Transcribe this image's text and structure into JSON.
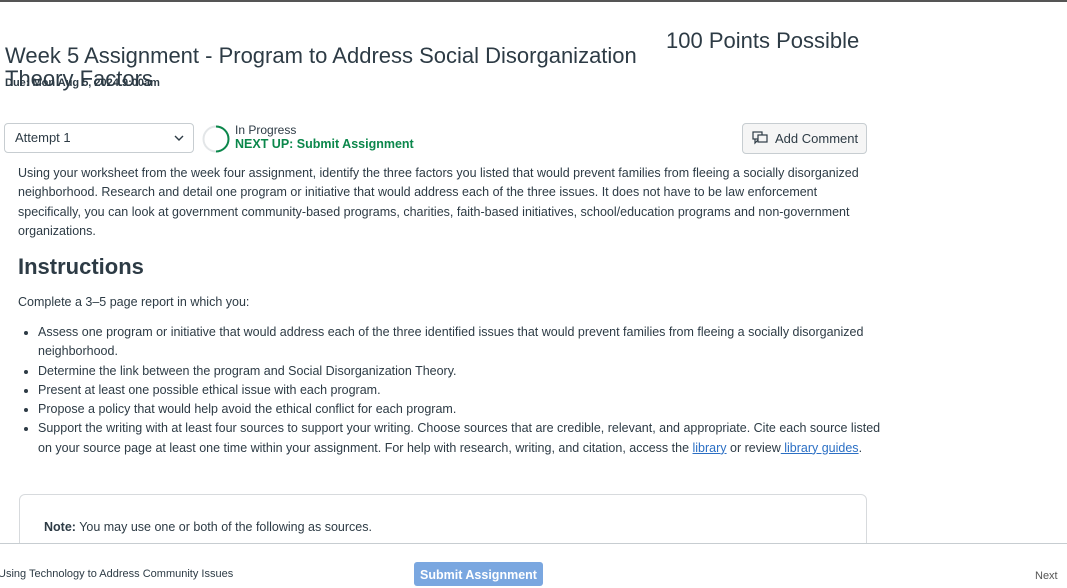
{
  "assignment": {
    "title": "Week 5 Assignment - Program to Address Social Disorganization Theory Factors",
    "points": "100 Points Possible",
    "due": "Due: Mon Aug 5, 2024 9:00am"
  },
  "attempt": {
    "selected": "Attempt 1",
    "status": "In Progress",
    "next_step": "NEXT UP: Submit Assignment"
  },
  "actions": {
    "add_comment": "Add Comment"
  },
  "body": {
    "intro_paragraph": "Using your worksheet from the week four assignment, identify the three factors you listed that would prevent families from fleeing a socially disorganized neighborhood. Research and detail one program or initiative that would address each of the three issues. It does not have to be law enforcement specifically, you can look at government community-based programs, charities, faith-based initiatives, school/education programs and non-government organizations.",
    "instructions_heading": "Instructions",
    "instructions_intro": "Complete a 3–5 page report in which you:",
    "bullets": [
      "Assess one program or initiative that would address each of the three identified issues that would prevent families from fleeing a socially disorganized neighborhood.",
      "Determine the link between the program and Social Disorganization Theory.",
      "Present at least one possible ethical issue with each program.",
      "Propose a policy that would help avoid the ethical conflict for each program."
    ],
    "last_bullet": {
      "text": "Support the writing with at least four sources to support your writing. Choose sources that are credible, relevant, and appropriate. Cite each source listed on your source page at least one time within your assignment. For help with research, writing, and citation, access the ",
      "link1": "library",
      "mid": " or review",
      "link2": " library guides",
      "end": "."
    },
    "note_label": "Note:",
    "note_text": " You may use one or both of the following as sources."
  },
  "footer": {
    "previous": "Using Technology to Address Community Issues",
    "submit": "Submit Assignment",
    "next": "Next"
  }
}
